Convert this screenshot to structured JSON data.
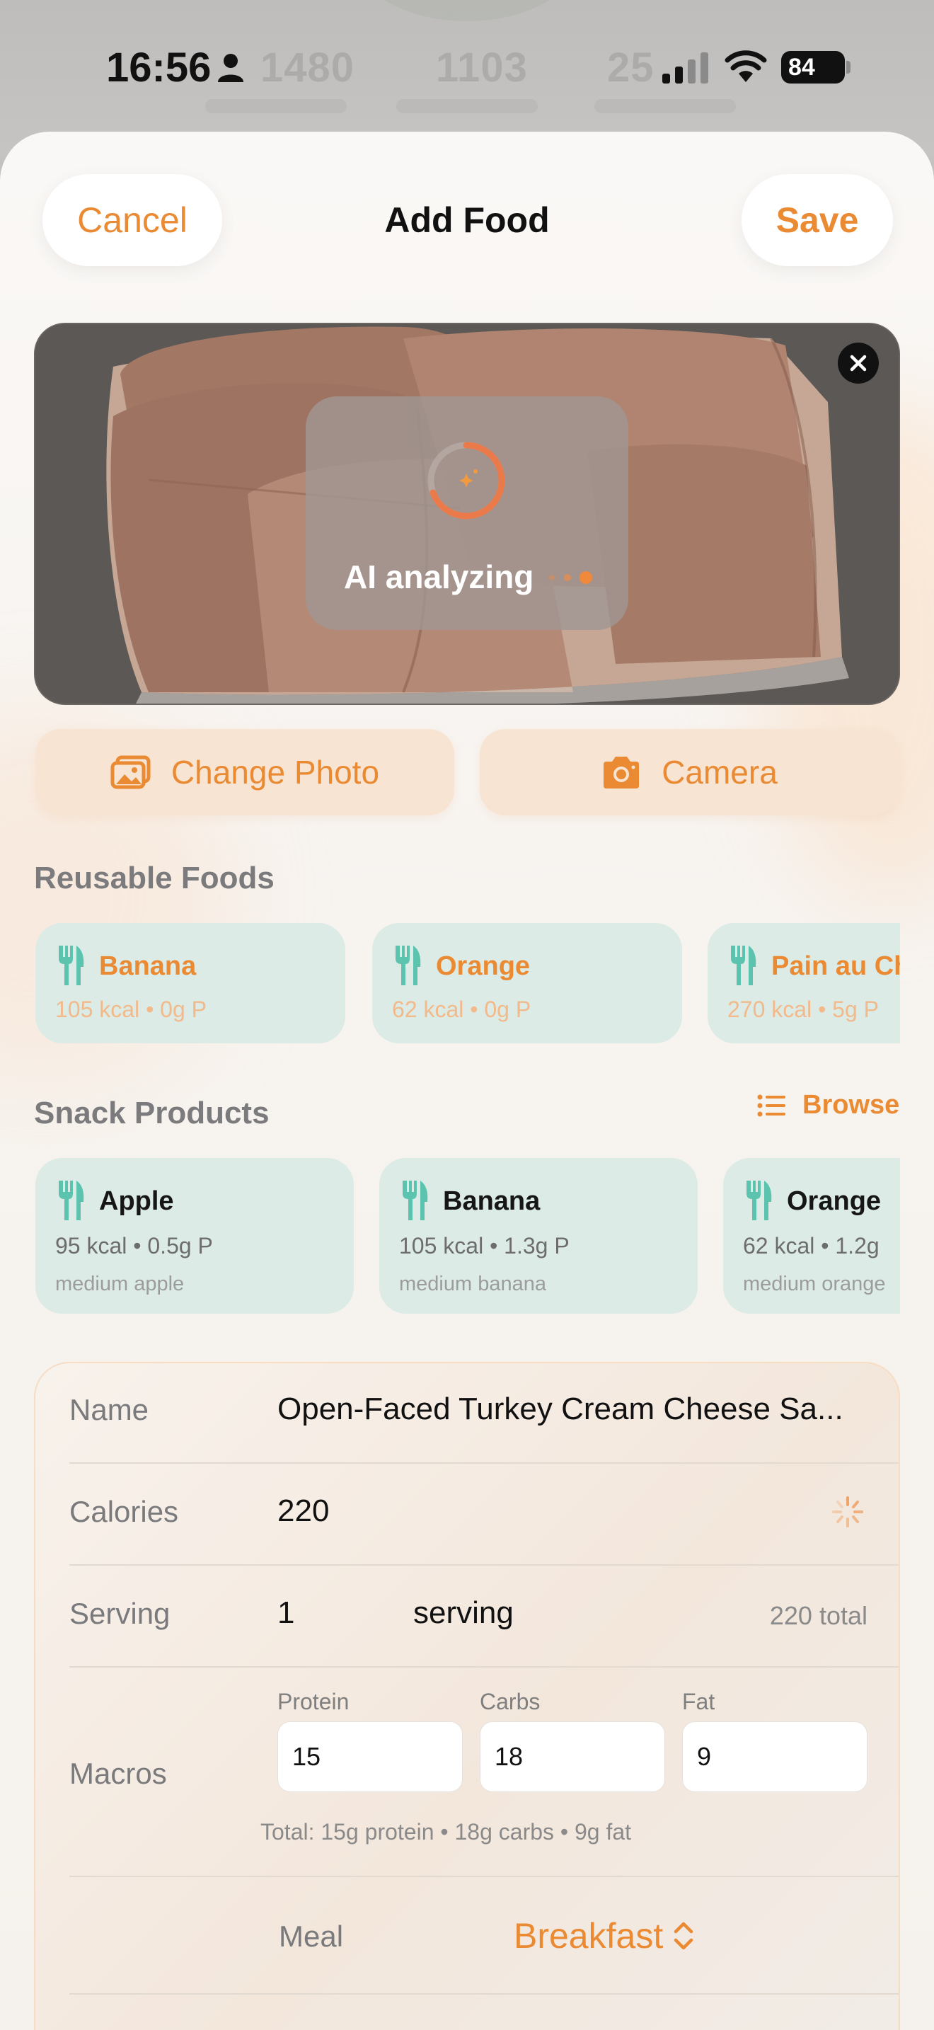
{
  "status_bar": {
    "time": "16:56",
    "battery": "84",
    "background_stats": [
      "1480",
      "1103",
      "25"
    ]
  },
  "sheet": {
    "title": "Add Food",
    "cancel_label": "Cancel",
    "save_label": "Save"
  },
  "photo": {
    "status_text": "AI analyzing"
  },
  "photo_actions": {
    "change_photo_label": "Change Photo",
    "camera_label": "Camera"
  },
  "reusable_foods": {
    "title": "Reusable Foods",
    "items": [
      {
        "name": "Banana",
        "detail": "105 kcal • 0g P"
      },
      {
        "name": "Orange",
        "detail": "62 kcal • 0g P"
      },
      {
        "name": "Pain au Ch",
        "detail": "270 kcal • 5g P"
      }
    ]
  },
  "snack_products": {
    "title": "Snack Products",
    "browse_label": "Browse",
    "items": [
      {
        "name": "Apple",
        "detail": "95 kcal • 0.5g P",
        "note": "medium apple"
      },
      {
        "name": "Banana",
        "detail": "105 kcal • 1.3g P",
        "note": "medium banana"
      },
      {
        "name": "Orange",
        "detail": "62 kcal • 1.2g",
        "note": "medium orange"
      }
    ]
  },
  "form": {
    "name_label": "Name",
    "name_value": "Open-Faced Turkey Cream Cheese Sa...",
    "calories_label": "Calories",
    "calories_value": "220",
    "serving_label": "Serving",
    "serving_amount": "1",
    "serving_unit": "serving",
    "serving_total": "220 total",
    "macros_label": "Macros",
    "protein_label": "Protein",
    "protein_value": "15",
    "carbs_label": "Carbs",
    "carbs_value": "18",
    "fat_label": "Fat",
    "fat_value": "9",
    "macros_total": "Total: 15g protein • 18g carbs • 9g fat",
    "meal_label": "Meal",
    "meal_value": "Breakfast"
  },
  "colors": {
    "accent": "#EA8A33",
    "card_teal": "#DCEBE6",
    "icon_teal": "#5BC3AE",
    "photo_button_bg": "#F7E4D3"
  },
  "icons": [
    "person-icon",
    "signal-icon",
    "wifi-icon",
    "close-icon",
    "spinner-icon",
    "gallery-icon",
    "camera-icon",
    "fork-knife-icon",
    "list-icon",
    "activity-spinner-icon",
    "chevron-up-down-icon"
  ]
}
